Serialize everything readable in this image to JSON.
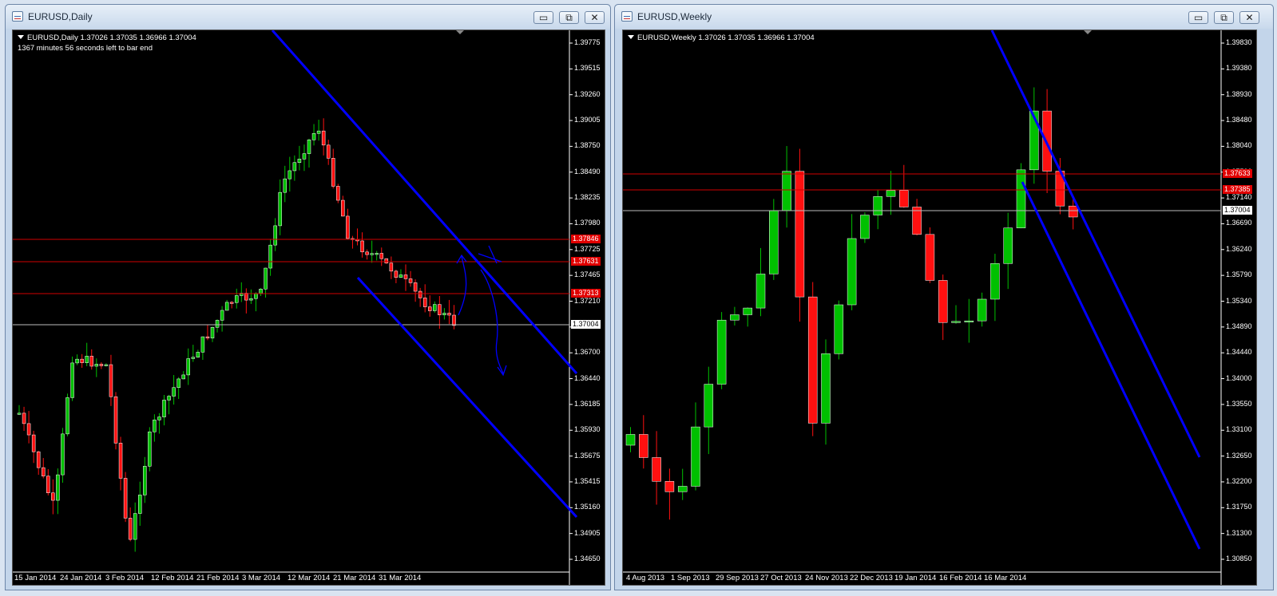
{
  "windows": [
    {
      "title": "EURUSD,Daily",
      "info_line": "EURUSD,Daily  1.37026 1.37035 1.36966 1.37004",
      "timer_line": "1367 minutes 56 seconds left to bar end",
      "controls": {
        "minimize": "▭",
        "restore": "⧉",
        "close": "✕"
      },
      "price_axis": [
        "1.39775",
        "1.39515",
        "1.39260",
        "1.39005",
        "1.38750",
        "1.38490",
        "1.38235",
        "1.37980",
        "1.37725",
        "1.37465",
        "1.37210",
        "1.36955",
        "1.36700",
        "1.36440",
        "1.36185",
        "1.35930",
        "1.35675",
        "1.35415",
        "1.35160",
        "1.34905",
        "1.34650"
      ],
      "time_axis": [
        "15 Jan 2014",
        "24 Jan 2014",
        "3 Feb 2014",
        "12 Feb 2014",
        "21 Feb 2014",
        "3 Mar 2014",
        "12 Mar 2014",
        "21 Mar 2014",
        "31 Mar 2014"
      ],
      "level_tags": [
        "1.37846",
        "1.37631",
        "1.37313"
      ],
      "current_price": "1.37004"
    },
    {
      "title": "EURUSD,Weekly",
      "info_line": "EURUSD,Weekly  1.37026 1.37035 1.36966 1.37004",
      "controls": {
        "minimize": "▭",
        "restore": "⧉",
        "close": "✕"
      },
      "price_axis": [
        "1.39830",
        "1.39380",
        "1.38930",
        "1.38480",
        "1.38040",
        "1.37590",
        "1.37140",
        "1.36690",
        "1.36240",
        "1.35790",
        "1.35340",
        "1.34890",
        "1.34440",
        "1.34000",
        "1.33550",
        "1.33100",
        "1.32650",
        "1.32200",
        "1.31750",
        "1.31300",
        "1.30850"
      ],
      "time_axis": [
        "4 Aug 2013",
        "1 Sep 2013",
        "29 Sep 2013",
        "27 Oct 2013",
        "24 Nov 2013",
        "22 Dec 2013",
        "19 Jan 2014",
        "16 Feb 2014",
        "16 Mar 2014"
      ],
      "level_tags": [
        "1.37633",
        "1.37385"
      ],
      "current_price": "1.37004"
    }
  ],
  "colors": {
    "bull": "#00c000",
    "bear": "#ff1010",
    "channel": "#0000ff",
    "level": "#d00000"
  }
}
